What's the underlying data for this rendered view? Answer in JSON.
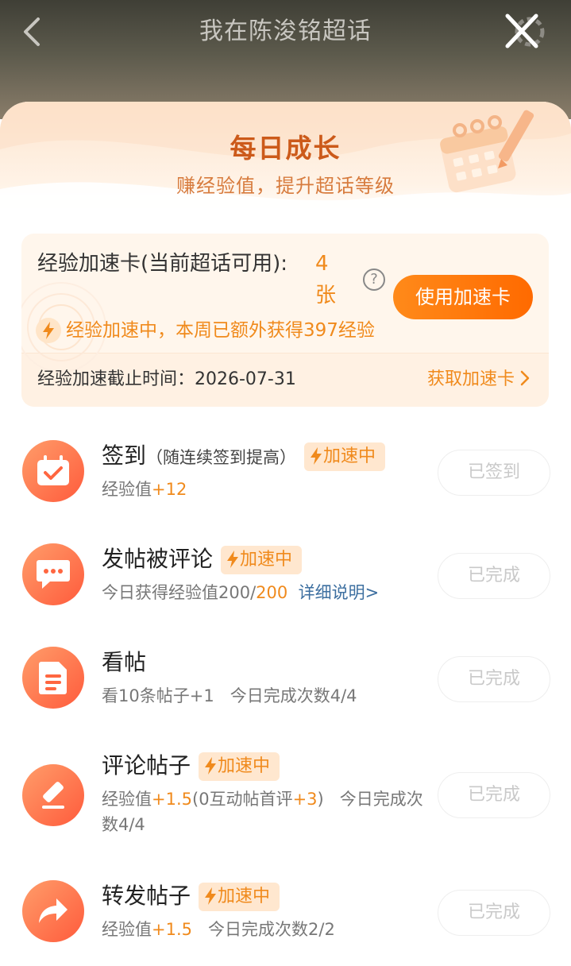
{
  "nav": {
    "title": "我在陈浚铭超话"
  },
  "header": {
    "title": "每日成长",
    "subtitle": "赚经验值，提升超话等级"
  },
  "speed_card": {
    "label": "经验加速卡(当前超话可用):",
    "count": "4张",
    "help": "?",
    "use_button": "使用加速卡",
    "boost_status": "经验加速中，本周已额外获得397经验",
    "deadline": "经验加速截止时间：2026-07-31",
    "get_link": "获取加速卡"
  },
  "badge_text": "加速中",
  "tasks": [
    {
      "name": "签到",
      "hint": "（随连续签到提高）",
      "boost": true,
      "desc_prefix": "经验值",
      "desc_value": "+12",
      "button": "已签到"
    },
    {
      "name": "发帖被评论",
      "boost": true,
      "desc_prefix": "今日获得经验值200/",
      "desc_value": "200",
      "desc_link": "详细说明>",
      "button": "已完成"
    },
    {
      "name": "看帖",
      "boost": false,
      "desc": "看10条帖子+1   今日完成次数4/4",
      "button": "已完成"
    },
    {
      "name": "评论帖子",
      "boost": true,
      "desc_a": "经验值",
      "desc_b": "+1.5",
      "desc_c": "(0互动帖首评",
      "desc_d": "+3",
      "desc_e": ")   今日完成次数4/4",
      "button": "已完成"
    },
    {
      "name": "转发帖子",
      "boost": true,
      "desc_prefix": "经验值",
      "desc_value": "+1.5",
      "desc_suffix": "   今日完成次数2/2",
      "button": "已完成"
    }
  ],
  "colors": {
    "accent": "#f08a1c",
    "title_orange": "#cc5a1a",
    "icon_gradient_start": "#ff9d6a",
    "icon_gradient_end": "#ff5b3c",
    "link": "#3d6fa0"
  }
}
